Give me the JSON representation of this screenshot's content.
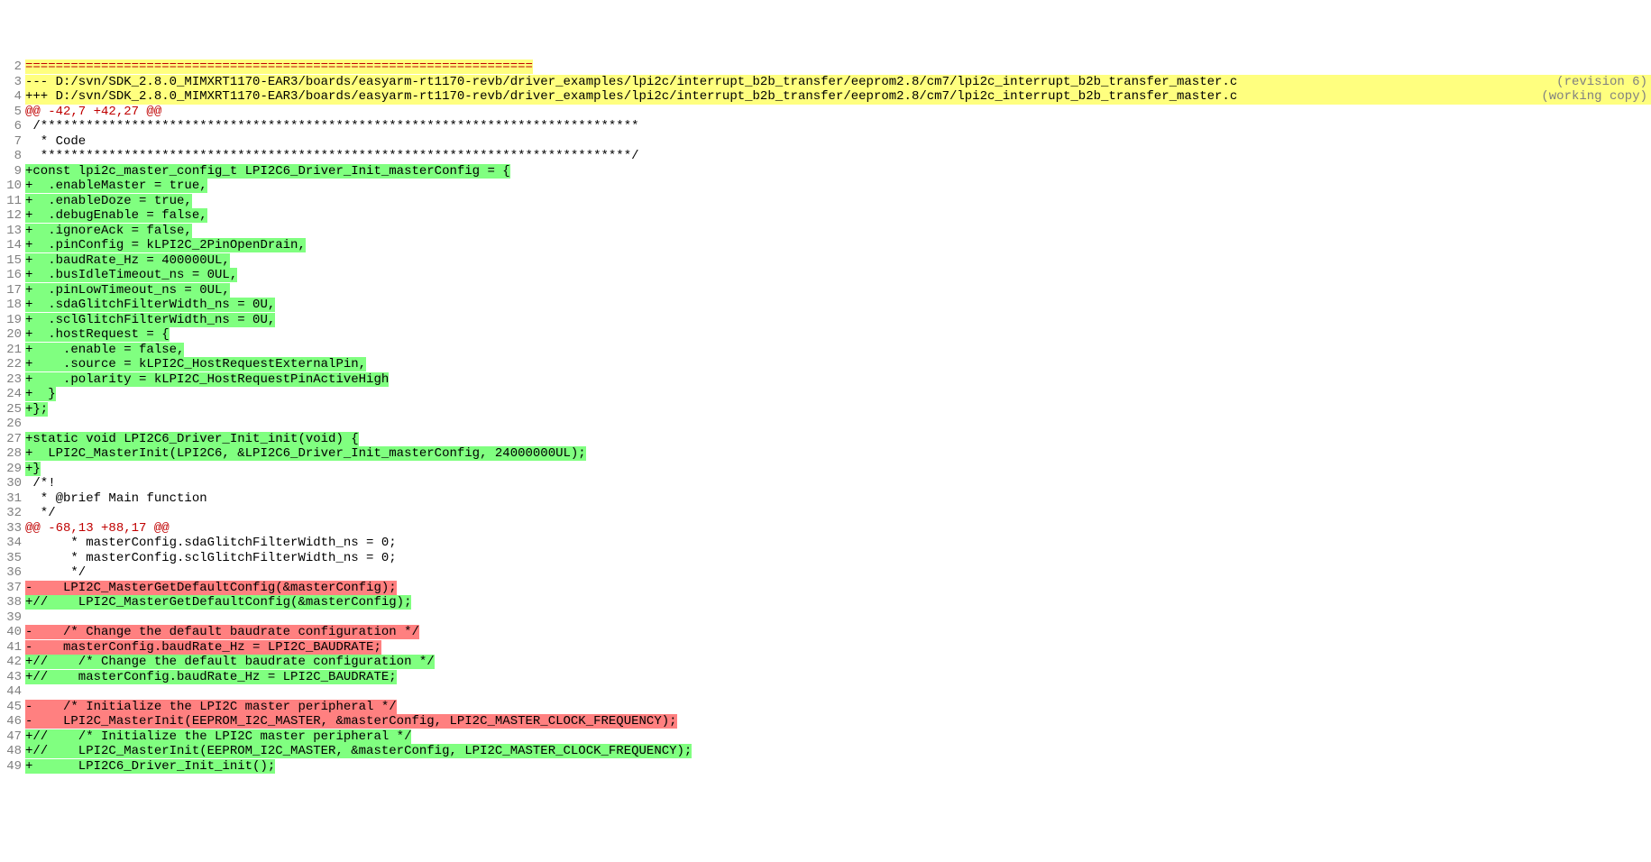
{
  "lines": [
    {
      "num": 2,
      "parts": [
        {
          "text": "===================================================================",
          "cls": "bg-yellow fg-red"
        }
      ]
    },
    {
      "num": 3,
      "parts": [
        {
          "text": "--- D:/svn/SDK_2.8.0_MIMXRT1170-EAR3/boards/easyarm-rt1170-revb/driver_examples/lpi2c/interrupt_b2b_transfer/eeprom2.8/cm7/lpi2c_interrupt_b2b_transfer_master.c",
          "cls": "bg-yellow"
        },
        {
          "text": "    ",
          "cls": "bg-yellow"
        },
        {
          "text": "(revision 6)",
          "cls": "bg-yellow rev-label"
        }
      ]
    },
    {
      "num": 4,
      "parts": [
        {
          "text": "+++ D:/svn/SDK_2.8.0_MIMXRT1170-EAR3/boards/easyarm-rt1170-revb/driver_examples/lpi2c/interrupt_b2b_transfer/eeprom2.8/cm7/lpi2c_interrupt_b2b_transfer_master.c",
          "cls": "bg-yellow"
        },
        {
          "text": "    ",
          "cls": "bg-yellow"
        },
        {
          "text": "(working copy)",
          "cls": "bg-yellow rev-label"
        }
      ]
    },
    {
      "num": 5,
      "parts": [
        {
          "text": "@@ -42,7 +42,27 @@",
          "cls": "fg-red"
        }
      ]
    },
    {
      "num": 6,
      "parts": [
        {
          "text": " /*******************************************************************************",
          "cls": ""
        }
      ]
    },
    {
      "num": 7,
      "parts": [
        {
          "text": "  * Code",
          "cls": ""
        }
      ]
    },
    {
      "num": 8,
      "parts": [
        {
          "text": "  ******************************************************************************/",
          "cls": ""
        }
      ]
    },
    {
      "num": 9,
      "parts": [
        {
          "text": "+const lpi2c_master_config_t LPI2C6_Driver_Init_masterConfig = {",
          "cls": "bg-green"
        }
      ]
    },
    {
      "num": 10,
      "parts": [
        {
          "text": "+  .enableMaster = true,",
          "cls": "bg-green"
        }
      ]
    },
    {
      "num": 11,
      "parts": [
        {
          "text": "+  .enableDoze = true,",
          "cls": "bg-green"
        }
      ]
    },
    {
      "num": 12,
      "parts": [
        {
          "text": "+  .debugEnable = false,",
          "cls": "bg-green"
        }
      ]
    },
    {
      "num": 13,
      "parts": [
        {
          "text": "+  .ignoreAck = false,",
          "cls": "bg-green"
        }
      ]
    },
    {
      "num": 14,
      "parts": [
        {
          "text": "+  .pinConfig = kLPI2C_2PinOpenDrain,",
          "cls": "bg-green"
        }
      ]
    },
    {
      "num": 15,
      "parts": [
        {
          "text": "+  .baudRate_Hz = 400000UL,",
          "cls": "bg-green"
        }
      ]
    },
    {
      "num": 16,
      "parts": [
        {
          "text": "+  .busIdleTimeout_ns = 0UL,",
          "cls": "bg-green"
        }
      ]
    },
    {
      "num": 17,
      "parts": [
        {
          "text": "+  .pinLowTimeout_ns = 0UL,",
          "cls": "bg-green"
        }
      ]
    },
    {
      "num": 18,
      "parts": [
        {
          "text": "+  .sdaGlitchFilterWidth_ns = 0U,",
          "cls": "bg-green"
        }
      ]
    },
    {
      "num": 19,
      "parts": [
        {
          "text": "+  .sclGlitchFilterWidth_ns = 0U,",
          "cls": "bg-green"
        }
      ]
    },
    {
      "num": 20,
      "parts": [
        {
          "text": "+  .hostRequest = {",
          "cls": "bg-green"
        }
      ]
    },
    {
      "num": 21,
      "parts": [
        {
          "text": "+    .enable = false,",
          "cls": "bg-green"
        }
      ]
    },
    {
      "num": 22,
      "parts": [
        {
          "text": "+    .source = kLPI2C_HostRequestExternalPin,",
          "cls": "bg-green"
        }
      ]
    },
    {
      "num": 23,
      "parts": [
        {
          "text": "+    .polarity = kLPI2C_HostRequestPinActiveHigh",
          "cls": "bg-green"
        }
      ]
    },
    {
      "num": 24,
      "parts": [
        {
          "text": "+  }",
          "cls": "bg-green"
        }
      ]
    },
    {
      "num": 25,
      "parts": [
        {
          "text": "+};",
          "cls": "bg-green"
        }
      ]
    },
    {
      "num": 26,
      "parts": [
        {
          "text": " ",
          "cls": ""
        }
      ]
    },
    {
      "num": 27,
      "parts": [
        {
          "text": "+static void LPI2C6_Driver_Init_init(void) {",
          "cls": "bg-green"
        }
      ]
    },
    {
      "num": 28,
      "parts": [
        {
          "text": "+  LPI2C_MasterInit(LPI2C6, &LPI2C6_Driver_Init_masterConfig, 24000000UL);",
          "cls": "bg-green"
        }
      ]
    },
    {
      "num": 29,
      "parts": [
        {
          "text": "+}",
          "cls": "bg-green"
        }
      ]
    },
    {
      "num": 30,
      "parts": [
        {
          "text": " /*!",
          "cls": ""
        }
      ]
    },
    {
      "num": 31,
      "parts": [
        {
          "text": "  * @brief Main function",
          "cls": ""
        }
      ]
    },
    {
      "num": 32,
      "parts": [
        {
          "text": "  */",
          "cls": ""
        }
      ]
    },
    {
      "num": 33,
      "parts": [
        {
          "text": "@@ -68,13 +88,17 @@",
          "cls": "fg-red"
        }
      ]
    },
    {
      "num": 34,
      "parts": [
        {
          "text": "      * masterConfig.sdaGlitchFilterWidth_ns = 0;",
          "cls": ""
        }
      ]
    },
    {
      "num": 35,
      "parts": [
        {
          "text": "      * masterConfig.sclGlitchFilterWidth_ns = 0;",
          "cls": ""
        }
      ]
    },
    {
      "num": 36,
      "parts": [
        {
          "text": "      */",
          "cls": ""
        }
      ]
    },
    {
      "num": 37,
      "parts": [
        {
          "text": "-    LPI2C_MasterGetDefaultConfig(&masterConfig);",
          "cls": "bg-red"
        }
      ]
    },
    {
      "num": 38,
      "parts": [
        {
          "text": "+//    LPI2C_MasterGetDefaultConfig(&masterConfig);",
          "cls": "bg-green"
        }
      ]
    },
    {
      "num": 39,
      "parts": [
        {
          "text": " ",
          "cls": ""
        }
      ]
    },
    {
      "num": 40,
      "parts": [
        {
          "text": "-    /* Change the default baudrate configuration */",
          "cls": "bg-red"
        }
      ]
    },
    {
      "num": 41,
      "parts": [
        {
          "text": "-    masterConfig.baudRate_Hz = LPI2C_BAUDRATE;",
          "cls": "bg-red"
        }
      ]
    },
    {
      "num": 42,
      "parts": [
        {
          "text": "+//    /* Change the default baudrate configuration */",
          "cls": "bg-green"
        }
      ]
    },
    {
      "num": 43,
      "parts": [
        {
          "text": "+//    masterConfig.baudRate_Hz = LPI2C_BAUDRATE;",
          "cls": "bg-green"
        }
      ]
    },
    {
      "num": 44,
      "parts": [
        {
          "text": " ",
          "cls": ""
        }
      ]
    },
    {
      "num": 45,
      "parts": [
        {
          "text": "-    /* Initialize the LPI2C master peripheral */",
          "cls": "bg-red"
        }
      ]
    },
    {
      "num": 46,
      "parts": [
        {
          "text": "-    LPI2C_MasterInit(EEPROM_I2C_MASTER, &masterConfig, LPI2C_MASTER_CLOCK_FREQUENCY);",
          "cls": "bg-red"
        }
      ]
    },
    {
      "num": 47,
      "parts": [
        {
          "text": "+//    /* Initialize the LPI2C master peripheral */",
          "cls": "bg-green"
        }
      ]
    },
    {
      "num": 48,
      "parts": [
        {
          "text": "+//    LPI2C_MasterInit(EEPROM_I2C_MASTER, &masterConfig, LPI2C_MASTER_CLOCK_FREQUENCY);",
          "cls": "bg-green"
        }
      ]
    },
    {
      "num": 49,
      "parts": [
        {
          "text": "+      LPI2C6_Driver_Init_init();",
          "cls": "bg-green"
        }
      ]
    }
  ]
}
